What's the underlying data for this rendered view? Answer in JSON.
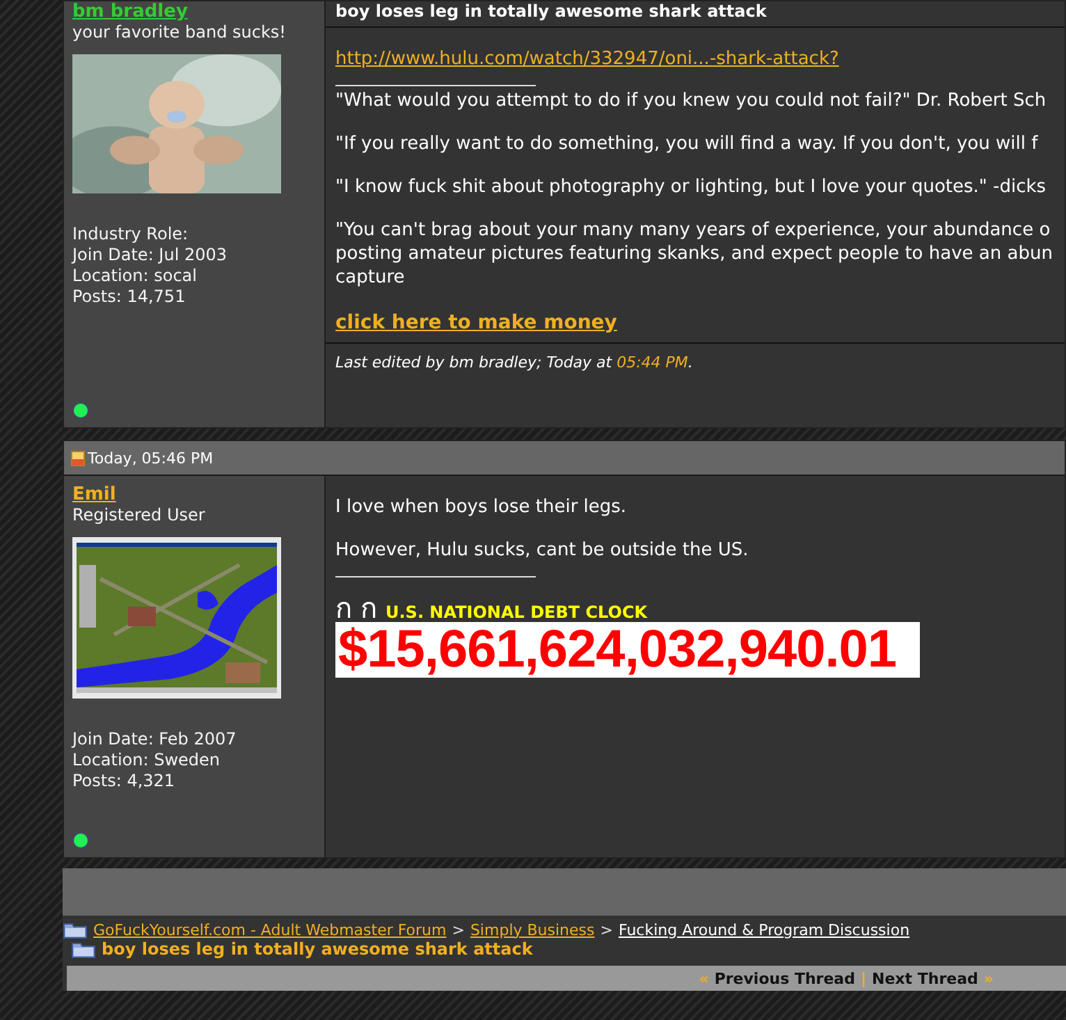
{
  "posts": [
    {
      "user": {
        "name": "bm bradley",
        "color": "#33cc33",
        "title": "your favorite band sucks!",
        "avatar": {
          "kind": "picture"
        },
        "info": [
          "Industry Role:",
          "Join Date: Jul 2003",
          "Location: socal",
          "Posts: 14,751"
        ],
        "online": true
      },
      "title": "boy loses leg in totally awesome shark attack",
      "message": [
        {
          "kind": "link",
          "text": "http://www.hulu.com/watch/332947/oni...-shark-attack?"
        }
      ],
      "signature": [
        {
          "kind": "text",
          "lines": [
            "\"What would you attempt to do if you knew you could not fail?\" Dr. Robert Sch"
          ]
        },
        {
          "kind": "text",
          "lines": [
            "\"If you really want to do something, you will find a way. If you don't, you will f"
          ]
        },
        {
          "kind": "text",
          "lines": [
            "\"I know fuck shit about photography or lighting, but I love your quotes.\" -dicks"
          ]
        },
        {
          "kind": "text",
          "lines": [
            "\"You can't brag about your many many years of experience, your abundance o",
            "posting amateur pictures featuring skanks, and expect people to have an abun",
            "capture"
          ]
        },
        {
          "kind": "bold-link",
          "text": "click here to make money"
        }
      ],
      "edit_note": {
        "text": "Last edited by bm bradley; Today at",
        "time": "05:44 PM",
        "suffix": "."
      }
    },
    {
      "date": "Today, 05:46 PM",
      "user": {
        "name": "Emil",
        "color": "#f0b020",
        "title": "Registered User",
        "avatar": {
          "kind": "picture"
        },
        "info": [
          "Join Date: Feb 2007",
          "Location: Sweden",
          "Posts: 4,321"
        ],
        "online": true
      },
      "message": [
        {
          "kind": "text",
          "lines": [
            "I love when boys lose their legs."
          ]
        },
        {
          "kind": "text",
          "lines": [
            "However, Hulu sucks, cant be outside the US."
          ]
        }
      ],
      "signature": [
        {
          "kind": "debt-clock",
          "glyphs": [
            "ก",
            "ก"
          ],
          "label": "U.S. NATIONAL DEBT CLOCK",
          "amount": "$15,661,624,032,940.01"
        }
      ]
    }
  ],
  "breadcrumb": {
    "links": [
      "GoFuckYourself.com - Adult Webmaster Forum",
      "Simply Business",
      "Fucking Around & Program Discussion"
    ],
    "separator": ">",
    "current": "boy loses leg in totally awesome shark attack"
  },
  "thread_nav": {
    "prev_mark": "«",
    "prev": "Previous Thread",
    "divider": "|",
    "next": "Next Thread",
    "next_mark": "»"
  }
}
